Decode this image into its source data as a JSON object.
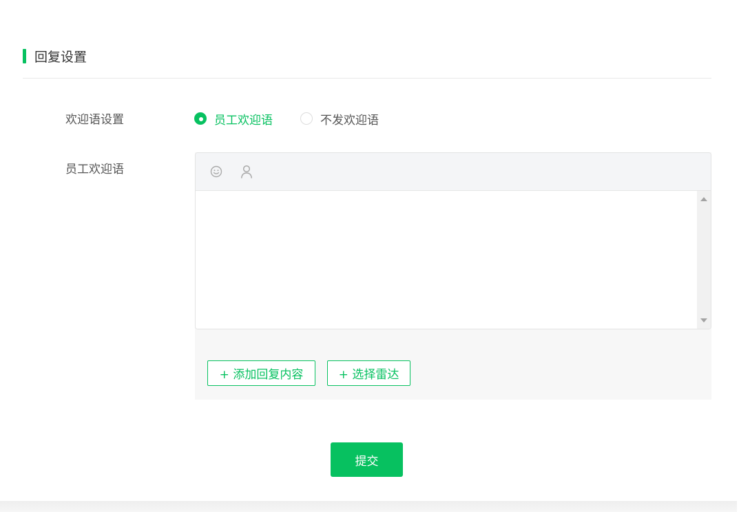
{
  "section": {
    "title": "回复设置"
  },
  "welcome_setting": {
    "label": "欢迎语设置",
    "options": [
      {
        "label": "员工欢迎语",
        "checked": true
      },
      {
        "label": "不发欢迎语",
        "checked": false
      }
    ]
  },
  "staff_welcome": {
    "label": "员工欢迎语",
    "toolbar_icons": [
      "emoji-icon",
      "user-icon"
    ],
    "content": "",
    "add_content_label": "+ 添加回复内容",
    "select_radar_label": "+ 选择雷达"
  },
  "submit": {
    "label": "提交"
  },
  "colors": {
    "accent": "#07c160",
    "toolbar_bg": "#f4f5f7",
    "panel_bg": "#f7f7f7"
  }
}
